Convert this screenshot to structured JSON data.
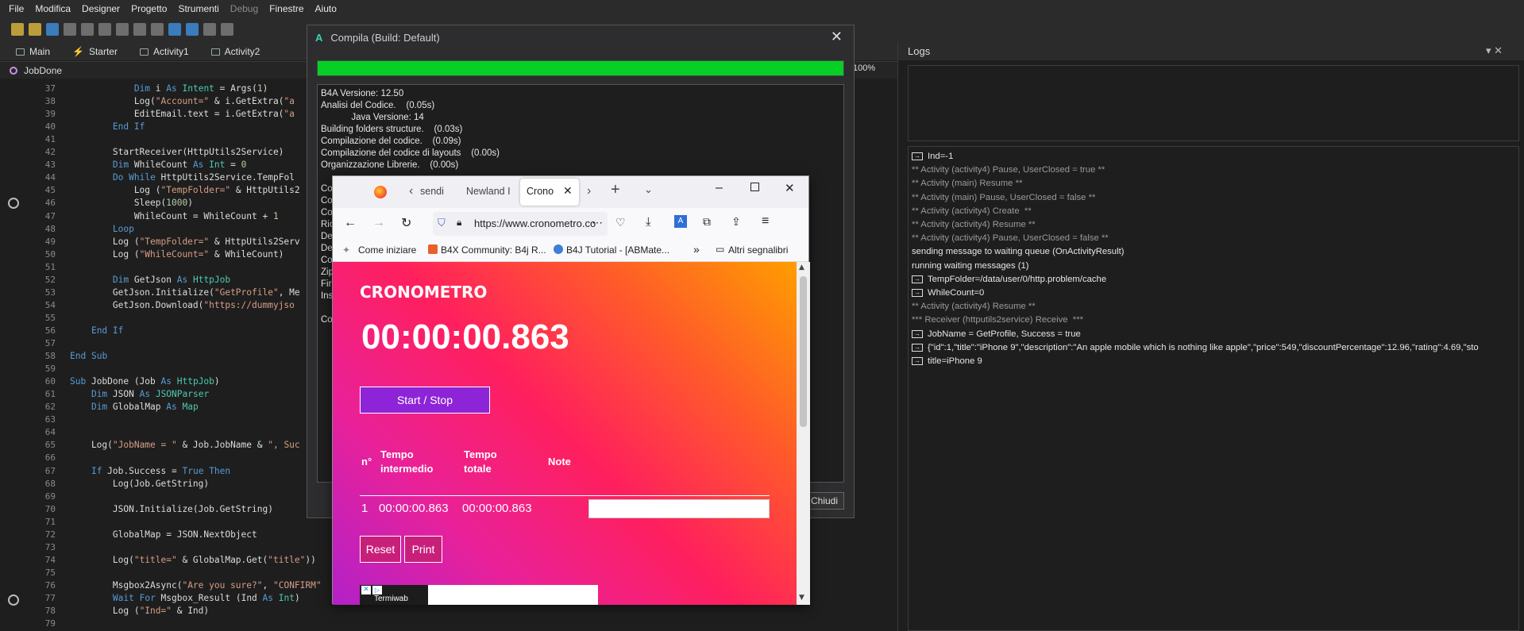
{
  "menu": [
    "File",
    "Modifica",
    "Designer",
    "Progetto",
    "Strumenti",
    "Debug",
    "Finestre",
    "Aiuto"
  ],
  "tabs": [
    {
      "label": "Main",
      "icon": "module-icon"
    },
    {
      "label": "Starter",
      "icon": "bolt-icon"
    },
    {
      "label": "Activity1",
      "icon": "module-icon"
    },
    {
      "label": "Activity2",
      "icon": "module-icon"
    }
  ],
  "module": {
    "name": "JobDone"
  },
  "zoom": "100%",
  "code": {
    "line_numbers": [
      "37",
      "38",
      "39",
      "40",
      "41",
      "42",
      "43",
      "44",
      "45",
      "46",
      "47",
      "48",
      "49",
      "50",
      "51",
      "52",
      "53",
      "54",
      "55",
      "56",
      "57",
      "58",
      "59",
      "60",
      "61",
      "62",
      "63",
      "64",
      "65",
      "66",
      "67",
      "68",
      "69",
      "70",
      "71",
      "72",
      "73",
      "74",
      "75",
      "76",
      "77",
      "78",
      "79"
    ],
    "lines": [
      "            Dim i As Intent = Args(1)",
      "            Log(\"Account=\" & i.GetExtra(\"a",
      "            EditEmail.text = i.GetExtra(\"a",
      "        End If",
      "",
      "        StartReceiver(HttpUtils2Service)",
      "        Dim WhileCount As Int = 0",
      "        Do While HttpUtils2Service.TempFol",
      "            Log (\"TempFolder=\" & HttpUtils2",
      "            Sleep(1000)",
      "            WhileCount = WhileCount + 1",
      "        Loop",
      "        Log (\"TempFolder=\" & HttpUtils2Serv",
      "        Log (\"WhileCount=\" & WhileCount)",
      "",
      "        Dim GetJson As HttpJob",
      "        GetJson.Initialize(\"GetProfile\", Me",
      "        GetJson.Download(\"https://dummyjso",
      "",
      "    End If",
      "",
      "End Sub",
      "",
      "Sub JobDone (Job As HttpJob)",
      "    Dim JSON As JSONParser",
      "    Dim GlobalMap As Map",
      "",
      "",
      "    Log(\"JobName = \" & Job.JobName & \", Suc",
      "",
      "    If Job.Success = True Then",
      "        Log(Job.GetString)",
      "",
      "        JSON.Initialize(Job.GetString)",
      "",
      "        GlobalMap = JSON.NextObject",
      "",
      "        Log(\"title=\" & GlobalMap.Get(\"title\"))",
      "",
      "        Msgbox2Async(\"Are you sure?\", \"CONFIRM\"",
      "        Wait For Msgbox_Result (Ind As Int)",
      "        Log (\"Ind=\" & Ind)",
      ""
    ]
  },
  "compile_dialog": {
    "title": "Compila (Build: Default)",
    "progress": 1.0,
    "log_lines": [
      "B4A Versione: 12.50",
      "Analisi del Codice.    (0.05s)",
      "            Java Versione: 14",
      "Building folders structure.    (0.03s)",
      "Compilazione del codice.    (0.09s)",
      "Compilazione del codice di layouts    (0.00s)",
      "Organizzazione Librerie.    (0.00s)",
      "",
      "Co",
      "Co",
      "Co",
      "Ric",
      "De",
      "De",
      "Co",
      "Zip",
      "Fir",
      "Ins",
      "",
      "Co"
    ],
    "close_label": "Chiudi"
  },
  "logs_panel": {
    "title": "Logs",
    "lines": [
      {
        "text": "Ind=-1",
        "arrow": true,
        "gray": false
      },
      {
        "text": "** Activity (activity4) Pause, UserClosed = true **",
        "arrow": false,
        "gray": true
      },
      {
        "text": "** Activity (main) Resume **",
        "arrow": false,
        "gray": true
      },
      {
        "text": "** Activity (main) Pause, UserClosed = false **",
        "arrow": false,
        "gray": true
      },
      {
        "text": "** Activity (activity4) Create  **",
        "arrow": false,
        "gray": true
      },
      {
        "text": "** Activity (activity4) Resume **",
        "arrow": false,
        "gray": true
      },
      {
        "text": "** Activity (activity4) Pause, UserClosed = false **",
        "arrow": false,
        "gray": true
      },
      {
        "text": "sending message to waiting queue (OnActivityResult)",
        "arrow": false,
        "gray": false
      },
      {
        "text": "running waiting messages (1)",
        "arrow": false,
        "gray": false
      },
      {
        "text": "TempFolder=/data/user/0/http.problem/cache",
        "arrow": true,
        "gray": false
      },
      {
        "text": "WhileCount=0",
        "arrow": true,
        "gray": false
      },
      {
        "text": "** Activity (activity4) Resume **",
        "arrow": false,
        "gray": true
      },
      {
        "text": "*** Receiver (httputils2service) Receive  ***",
        "arrow": false,
        "gray": true
      },
      {
        "text": "JobName = GetProfile, Success = true",
        "arrow": true,
        "gray": false
      },
      {
        "text": "{\"id\":1,\"title\":\"iPhone 9\",\"description\":\"An apple mobile which is nothing like apple\",\"price\":549,\"discountPercentage\":12.96,\"rating\":4.69,\"sto",
        "arrow": true,
        "gray": false
      },
      {
        "text": "title=iPhone 9",
        "arrow": true,
        "gray": false
      }
    ]
  },
  "browser": {
    "tabs": [
      "sendi",
      "Newland I",
      "Crono"
    ],
    "url": "https://www.cronometro.co",
    "bookmarks": [
      "Come iniziare",
      "B4X Community: B4j R...",
      "B4J Tutorial - [ABMate..."
    ],
    "other_bookmarks": "Altri segnalibri",
    "page": {
      "title": "CRONOMETRO",
      "time": "00:00:00.863",
      "start_stop": "Start / Stop",
      "table_headers": [
        "n°",
        "Tempo intermedio",
        "Tempo totale",
        "Note"
      ],
      "rows": [
        {
          "n": "1",
          "intermedio": "00:00:00.863",
          "totale": "00:00:00.863",
          "note": ""
        }
      ],
      "reset": "Reset",
      "print": "Print",
      "ad_text": "Termiwab"
    }
  }
}
